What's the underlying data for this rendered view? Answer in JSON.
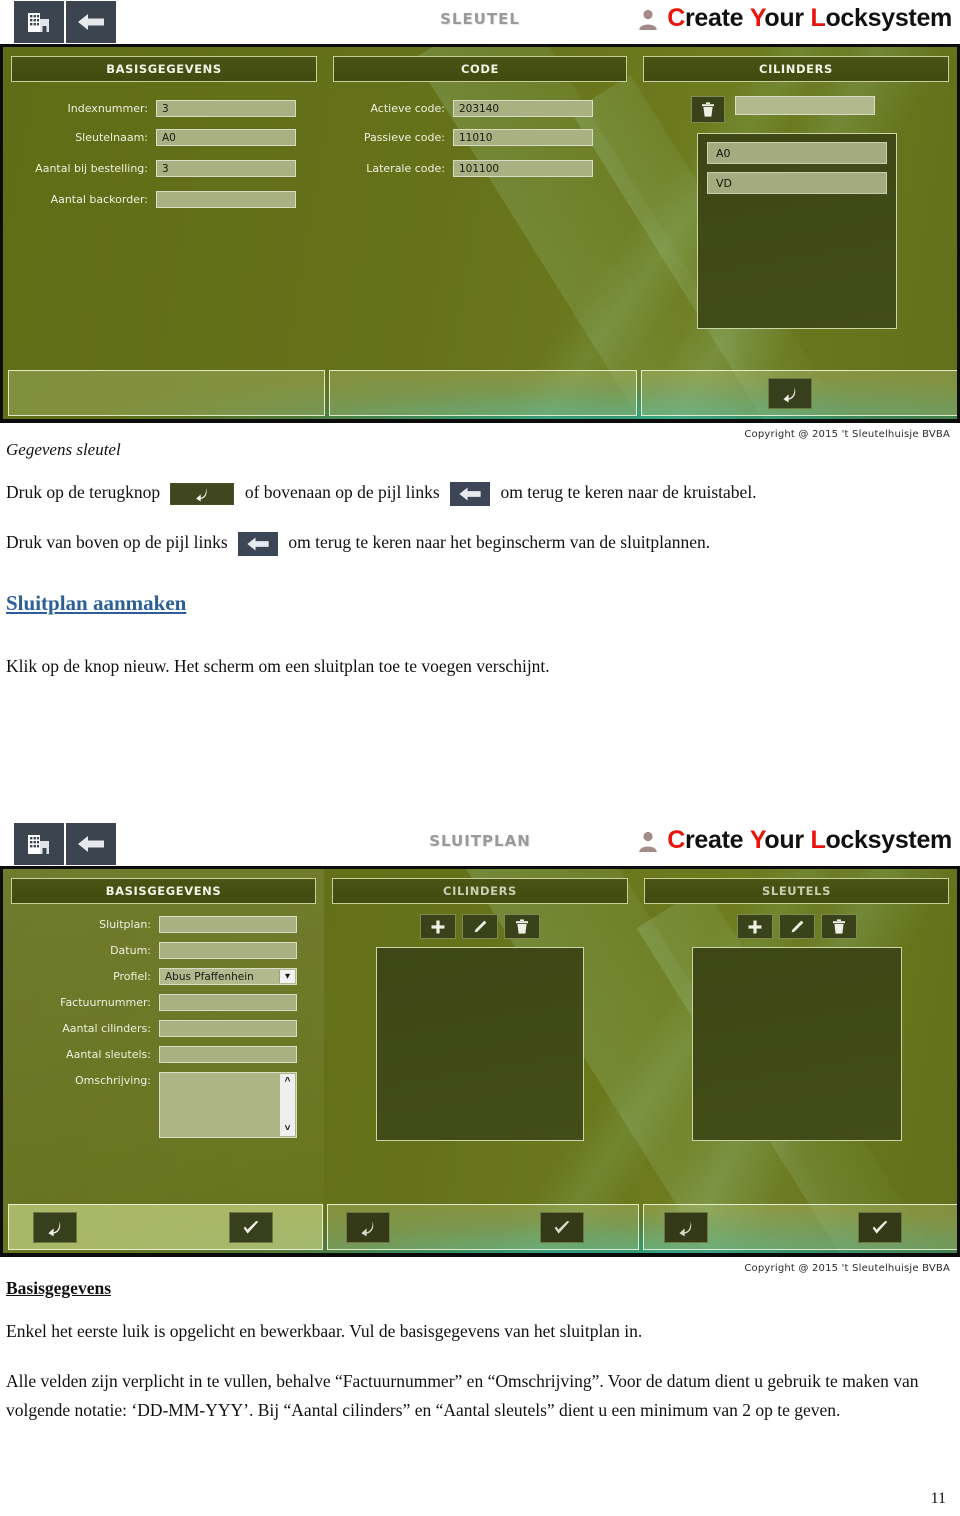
{
  "document": {
    "page_number": "11",
    "section_gegevens_sleutel": "Gegevens sleutel",
    "para1_a": "Druk op de terugknop",
    "para1_b": "of bovenaan op de pijl links",
    "para1_c": "om terug te keren naar de kruistabel.",
    "para2_a": "Druk van boven op de pijl links",
    "para2_b": "om terug te keren naar het beginscherm van de sluitplannen.",
    "heading_sluitplan_aanmaken": "Sluitplan aanmaken",
    "para3": "Klik op de knop nieuw. Het scherm om een sluitplan toe te voegen verschijnt.",
    "heading_basisgegevens": "Basisgegevens",
    "para4": "Enkel het eerste luik is opgelicht en bewerkbaar. Vul de basisgegevens van het sluitplan in.",
    "para5": " Alle velden zijn verplicht in te vullen, behalve “Factuurnummer” en “Omschrijving”. Voor de datum dient u gebruik te maken van volgende notatie: ‘DD-MM-YYY’. Bij “Aantal cilinders” en “Aantal sleutels” dient u een minimum van 2 op te geven."
  },
  "screenshot_sleutel": {
    "topbar": {
      "building_icon": "building-icon",
      "back_arrow_icon": "arrow-left-icon",
      "title": "SLEUTEL",
      "user_icon": "user-icon",
      "brand": {
        "c": "C",
        "reate": "reate",
        "y": "Y",
        "our": "our",
        "l": "L",
        "ocksystem": "ocksystem"
      }
    },
    "tabs": [
      {
        "label": "BASISGEGEVENS",
        "active": true
      },
      {
        "label": "CODE",
        "active": false
      },
      {
        "label": "CILINDERS",
        "active": false
      }
    ],
    "basisgegevens_fields": [
      {
        "label": "Indexnummer:",
        "value": "3"
      },
      {
        "label": "Sleutelnaam:",
        "value": "A0"
      },
      {
        "label": "Aantal bij bestelling:",
        "value": "3"
      },
      {
        "label": "Aantal backorder:",
        "value": ""
      }
    ],
    "code_fields": [
      {
        "label": "Actieve code:",
        "value": "203140"
      },
      {
        "label": "Passieve code:",
        "value": "11010"
      },
      {
        "label": "Laterale code:",
        "value": "101100"
      }
    ],
    "cilinders": {
      "delete_icon": "trash-icon",
      "dropdown_value": "",
      "dropdown_caret": "chevron-down-icon",
      "list_items": [
        "A0",
        "VD"
      ]
    },
    "footer": {
      "back_icon": "return-arrow-icon",
      "copyright": "Copyright @ 2015 't Sleutelhuisje BVBA"
    }
  },
  "screenshot_sluitplan": {
    "topbar": {
      "building_icon": "building-icon",
      "back_arrow_icon": "arrow-left-icon",
      "title": "SLUITPLAN",
      "user_icon": "user-icon",
      "brand": {
        "c": "C",
        "reate": "reate",
        "y": "Y",
        "our": "our",
        "l": "L",
        "ocksystem": "ocksystem"
      }
    },
    "tabs": [
      {
        "label": "BASISGEGEVENS",
        "active": true
      },
      {
        "label": "CILINDERS",
        "active": false
      },
      {
        "label": "SLEUTELS",
        "active": false
      }
    ],
    "basisgegevens_fields": [
      {
        "label": "Sluitplan:",
        "value": "",
        "type": "text"
      },
      {
        "label": "Datum:",
        "value": "",
        "type": "text"
      },
      {
        "label": "Profiel:",
        "value": "Abus Pfaffenhein",
        "type": "select"
      },
      {
        "label": "Factuurnummer:",
        "value": "",
        "type": "text"
      },
      {
        "label": "Aantal cilinders:",
        "value": "",
        "type": "text"
      },
      {
        "label": "Aantal sleutels:",
        "value": "",
        "type": "text"
      },
      {
        "label": "Omschrijving:",
        "value": "",
        "type": "textarea"
      }
    ],
    "cilinders_toolbar": [
      "plus-icon",
      "pencil-icon",
      "trash-icon"
    ],
    "sleutels_toolbar": [
      "plus-icon",
      "pencil-icon",
      "trash-icon"
    ],
    "footer": {
      "back_icon": "return-arrow-icon",
      "confirm_icon": "check-icon",
      "copyright": "Copyright @ 2015 't Sleutelhuisje BVBA"
    }
  },
  "colors": {
    "app_green": "#65721a",
    "panel_dark_green": "#434c12",
    "input_fill": "#a9b081",
    "topbar_button": "#3c444f",
    "brand_red": "#e8140c",
    "link_blue": "#2b5f96"
  }
}
